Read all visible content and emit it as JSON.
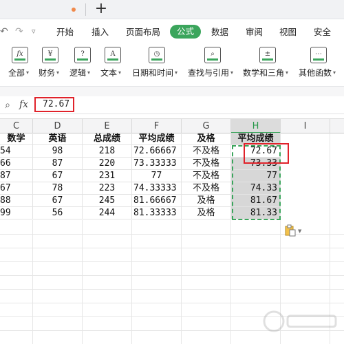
{
  "tabbar": {
    "new_tab_icon": "plus-icon"
  },
  "menu": {
    "items": [
      "开始",
      "插入",
      "页面布局",
      "公式",
      "数据",
      "审阅",
      "视图",
      "安全"
    ],
    "active": "公式"
  },
  "ribbon": {
    "items": [
      {
        "label": "全部",
        "icon": "fx-icon"
      },
      {
        "label": "财务",
        "icon": "yen-icon"
      },
      {
        "label": "逻辑",
        "icon": "question-icon"
      },
      {
        "label": "文本",
        "icon": "text-a-icon"
      },
      {
        "label": "日期和时间",
        "icon": "clock-icon"
      },
      {
        "label": "查找与引用",
        "icon": "search-ref-icon"
      },
      {
        "label": "数学和三角",
        "icon": "math-icon"
      },
      {
        "label": "其他函数",
        "icon": "more-functions-icon"
      }
    ]
  },
  "formula_bar": {
    "fx": "fx",
    "value": "72.67"
  },
  "columns": [
    "C",
    "D",
    "E",
    "F",
    "G",
    "H",
    "I"
  ],
  "selected_column": "H",
  "table": {
    "headers": [
      "数学",
      "英语",
      "总成绩",
      "平均成绩",
      "及格",
      "平均成绩"
    ],
    "rows": [
      [
        "54",
        "98",
        "218",
        "72.66667",
        "不及格",
        "72.67"
      ],
      [
        "66",
        "87",
        "220",
        "73.33333",
        "不及格",
        "73.33"
      ],
      [
        "87",
        "67",
        "231",
        "77",
        "不及格",
        "77"
      ],
      [
        "67",
        "78",
        "223",
        "74.33333",
        "不及格",
        "74.33"
      ],
      [
        "88",
        "67",
        "245",
        "81.66667",
        "及格",
        "81.67"
      ],
      [
        "99",
        "56",
        "244",
        "81.33333",
        "及格",
        "81.33"
      ]
    ]
  },
  "colors": {
    "accent": "#3ba55c",
    "highlight_red": "#e0222a"
  }
}
